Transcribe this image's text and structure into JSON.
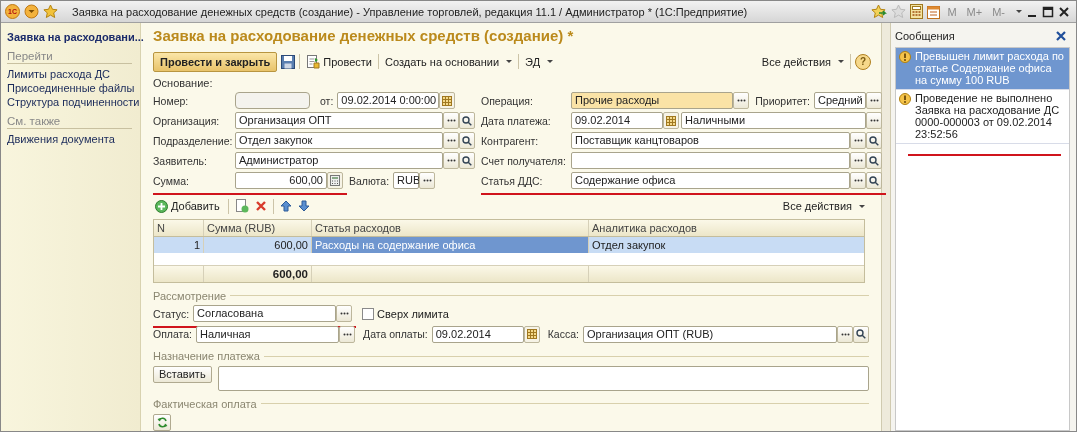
{
  "window": {
    "logo": "1С",
    "title": "Заявка на расходование денежных средств (создание) - Управление торговлей, редакция 11.1 / Администратор * (1С:Предприятие)",
    "memory_buttons": [
      {
        "label": "M",
        "disabled": true
      },
      {
        "label": "M+",
        "disabled": true
      },
      {
        "label": "M-",
        "disabled": true
      }
    ]
  },
  "sidebar": {
    "title": "Заявка на расходовани...",
    "sections": [
      {
        "heading": "Перейти",
        "items": [
          "Лимиты расхода ДС",
          "Присоединенные файлы",
          "Структура подчиненности"
        ]
      },
      {
        "heading": "См. также",
        "items": [
          "Движения документа"
        ]
      }
    ]
  },
  "form": {
    "title": "Заявка на расходование денежных средств (создание) *",
    "toolbar": {
      "post_close": "Провести и закрыть",
      "post": "Провести",
      "create_based": "Создать на основании",
      "ed": "ЭД",
      "all_actions": "Все действия",
      "help": "?"
    },
    "basis_label": "Основание:",
    "rows": [
      {
        "left": [
          {
            "kind": "field",
            "label": "Номер:",
            "field": {
              "kind": "number"
            },
            "underlined": false
          },
          {
            "kind": "field",
            "label": "от:",
            "field": {
              "kind": "datetime",
              "value": "09.02.2014  0:00:00"
            },
            "underlined": false
          }
        ],
        "right": [
          {
            "kind": "field",
            "label": "Операция:",
            "field": {
              "kind": "choice",
              "value": "Прочие расходы",
              "highlighted": true
            },
            "underlined": false
          },
          {
            "kind": "field",
            "label": "Приоритет:",
            "field": {
              "kind": "select",
              "value": "Средний",
              "highlighted": false
            },
            "underlined": false
          }
        ]
      },
      {
        "left": [
          {
            "kind": "field",
            "label": "Организация:",
            "field": {
              "kind": "ref",
              "value": "Организация ОПТ",
              "highlighted": false
            },
            "underlined": false
          }
        ],
        "right": [
          {
            "kind": "field",
            "label": "Дата платежа:",
            "field": {
              "kind": "date",
              "value": "09.02.2014"
            },
            "underlined": false
          },
          {
            "kind": "field",
            "field": {
              "kind": "choice",
              "value": "Наличными",
              "highlighted": false
            },
            "underlined": false
          }
        ]
      },
      {
        "left": [
          {
            "kind": "field",
            "label": "Подразделение:",
            "field": {
              "kind": "ref",
              "value": "Отдел закупок",
              "highlighted": false
            },
            "underlined": false
          }
        ],
        "right": [
          {
            "kind": "field",
            "label": "Контрагент:",
            "field": {
              "kind": "ref",
              "value": "Поставщик канцтоваров",
              "highlighted": false
            },
            "underlined": false
          }
        ]
      },
      {
        "left": [
          {
            "kind": "field",
            "label": "Заявитель:",
            "field": {
              "kind": "ref",
              "value": "Администратор",
              "highlighted": false
            },
            "underlined": false
          }
        ],
        "right": [
          {
            "kind": "field",
            "label": "Счет получателя:",
            "field": {
              "kind": "ref",
              "highlighted": false
            },
            "underlined": false
          }
        ]
      },
      {
        "left": [
          {
            "kind": "field",
            "label": "Сумма:",
            "field": {
              "kind": "calc",
              "value": "600,00"
            },
            "underlined": true
          },
          {
            "kind": "field",
            "label": "Валюта:",
            "field": {
              "kind": "currency",
              "value": "RUB",
              "highlighted": false
            },
            "underlined": false
          }
        ],
        "right": [
          {
            "kind": "field",
            "label": "Статья ДДС:",
            "field": {
              "kind": "ref",
              "value": "Содержание офиса",
              "highlighted": false
            },
            "underlined": true
          }
        ]
      }
    ],
    "table_toolbar": {
      "add": "Добавить",
      "all_actions": "Все действия"
    },
    "table": {
      "columns": [
        "N",
        "Сумма (RUB)",
        "Статья расходов",
        "Аналитика расходов"
      ],
      "rows": [
        {
          "selected": true,
          "cells": [
            {
              "text": "1",
              "current": false
            },
            {
              "text": "600,00",
              "current": false
            },
            {
              "text": "Расходы на содержание офиса",
              "current": true
            },
            {
              "text": "Отдел закупок",
              "current": false
            }
          ]
        }
      ],
      "total": "600,00"
    },
    "review": {
      "heading": "Рассмотрение",
      "rows": [
        [
          {
            "kind": "field",
            "label": "Статус:",
            "field": {
              "kind": "choice",
              "value": "Согласована",
              "highlighted": false
            },
            "underlined": true
          },
          {
            "kind": "checkbox",
            "label": "Сверх лимита",
            "checked": false
          }
        ],
        [
          {
            "kind": "field",
            "label": "Оплата:",
            "field": {
              "kind": "choice",
              "value": "Наличная",
              "highlighted": false
            },
            "underlined": false
          },
          {
            "kind": "field",
            "label": "Дата оплаты:",
            "field": {
              "kind": "date",
              "value": "09.02.2014"
            },
            "underlined": false
          },
          {
            "kind": "field",
            "label": "Касса:",
            "field": {
              "kind": "ref",
              "value": "Организация ОПТ (RUB)",
              "highlighted": false
            },
            "underlined": false
          }
        ]
      ]
    },
    "purpose": {
      "heading": "Назначение платежа",
      "insert_button": "Вставить"
    },
    "actual": {
      "heading": "Фактическая оплата"
    }
  },
  "messages": {
    "title": "Сообщения",
    "underlined": true,
    "items": [
      {
        "text": "Превышен лимит расхода по статье Содержание офиса на сумму 100 RUB",
        "selected": true
      },
      {
        "text": "Проведение не выполнено Заявка на расходование ДС 0000-000003 от 09.02.2014 23:52:56",
        "selected": false
      }
    ]
  }
}
